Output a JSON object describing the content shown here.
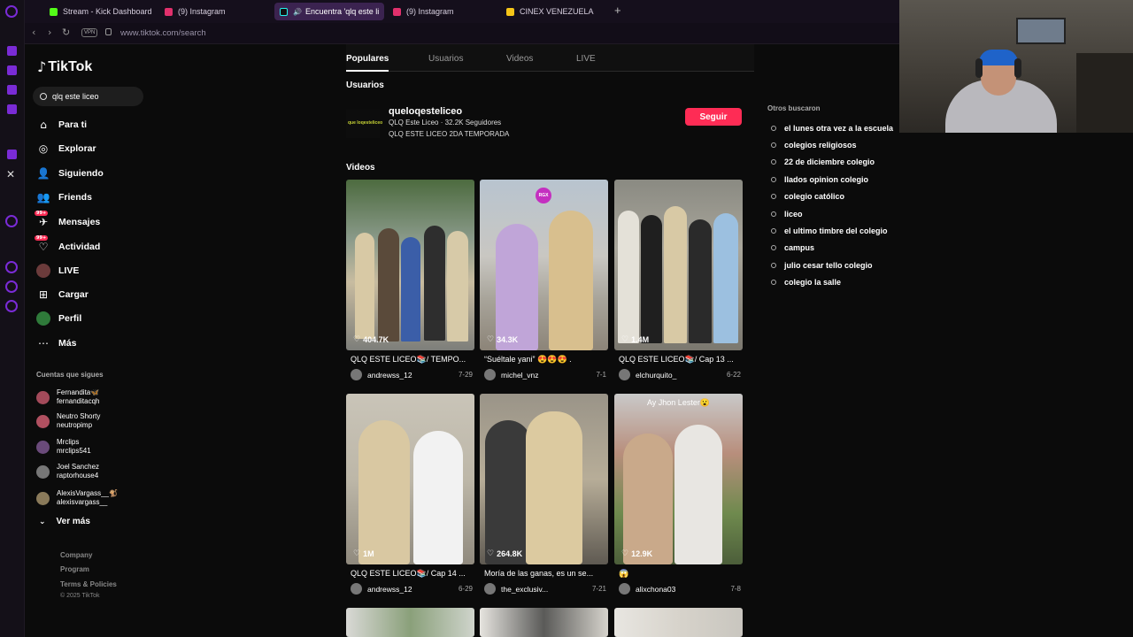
{
  "browser": {
    "tabs": [
      {
        "label": "Stream - Kick Dashboard",
        "color": "#53fc18",
        "active": false
      },
      {
        "label": "(9) Instagram",
        "color": "#e1306c",
        "active": false
      },
      {
        "label": "Encuentra 'qlq este li",
        "color": "#25f4ee",
        "active": true
      },
      {
        "label": "(9) Instagram",
        "color": "#e1306c",
        "active": false
      },
      {
        "label": "CINEX VENEZUELA",
        "color": "#f5c518",
        "active": false
      }
    ],
    "vpn": "VPN",
    "url": "www.tiktok.com/search"
  },
  "sidebar": {
    "brand": "TikTok",
    "search_value": "qlq este liceo",
    "menu": [
      {
        "label": "Para ti",
        "icon": "home-icon"
      },
      {
        "label": "Explorar",
        "icon": "compass-icon"
      },
      {
        "label": "Siguiendo",
        "icon": "user-follow-icon"
      },
      {
        "label": "Friends",
        "icon": "friends-icon"
      },
      {
        "label": "Mensajes",
        "icon": "message-icon",
        "badge": "99+"
      },
      {
        "label": "Actividad",
        "icon": "activity-icon",
        "badge": "99+"
      },
      {
        "label": "LIVE",
        "icon": "live-icon"
      },
      {
        "label": "Cargar",
        "icon": "upload-icon"
      },
      {
        "label": "Perfil",
        "icon": "profile-icon"
      },
      {
        "label": "Más",
        "icon": "more-icon"
      }
    ],
    "following_title": "Cuentas que sigues",
    "following": [
      {
        "name": "Fernandita🦋",
        "handle": "fernanditacqh"
      },
      {
        "name": "Neutro Shorty",
        "handle": "neutropimp"
      },
      {
        "name": "Mrclips",
        "handle": "mrclips541"
      },
      {
        "name": "Joel Sanchez",
        "handle": "raptorhouse4"
      },
      {
        "name": "AlexisVargass__🐒",
        "handle": "alexisvargass__"
      }
    ],
    "see_more": "Ver más",
    "footer": [
      "Company",
      "Program",
      "Terms & Policies"
    ],
    "copyright": "© 2025 TikTok"
  },
  "search_tabs": [
    "Populares",
    "Usuarios",
    "Videos",
    "LIVE"
  ],
  "users_title": "Usuarios",
  "user": {
    "avatar_text": "que loqesteliceo",
    "username": "queloqesteliceo",
    "meta": "QLQ Este Liceo · 32.2K Seguidores",
    "desc": "QLQ ESTE LICEO 2DA TEMPORADA",
    "follow": "Seguir"
  },
  "videos_title": "Videos",
  "videos": [
    {
      "likes": "404.7K",
      "caption": "QLQ ESTE LICEO📚/ TEMPO...",
      "author": "andrewss_12",
      "date": "7-29"
    },
    {
      "likes": "34.3K",
      "caption": "“Suéltale yani” 😍😍😍 .",
      "author": "michel_vnz",
      "date": "7-1",
      "badge": "RGX"
    },
    {
      "likes": "1.4M",
      "caption": "QLQ ESTE LICEO📚/ Cap 13 ...",
      "author": "elchurquito_",
      "date": "6-22"
    },
    {
      "likes": "1M",
      "caption": "QLQ ESTE LICEO📚/ Cap 14 ...",
      "author": "andrewss_12",
      "date": "6-29"
    },
    {
      "likes": "264.8K",
      "caption": "Moría de las ganas, es un se...",
      "author": "the_exclusiv...",
      "date": "7-21"
    },
    {
      "likes": "12.9K",
      "caption": "😱",
      "author": "alixchona03",
      "date": "7-8",
      "overlay": "Ay Jhon Lester😮"
    }
  ],
  "others_title": "Otros buscaron",
  "suggestions": [
    "el lunes otra vez a la escuela",
    "colegios religiosos",
    "22 de diciembre colegio",
    "llados opinion colegio",
    "colegio católico",
    "liceo",
    "el ultimo timbre del colegio",
    "campus",
    "julio cesar tello colegio",
    "colegio la salle"
  ],
  "colors": {
    "accent": "#fe2c55",
    "browser_purple": "#7a2bd6"
  }
}
